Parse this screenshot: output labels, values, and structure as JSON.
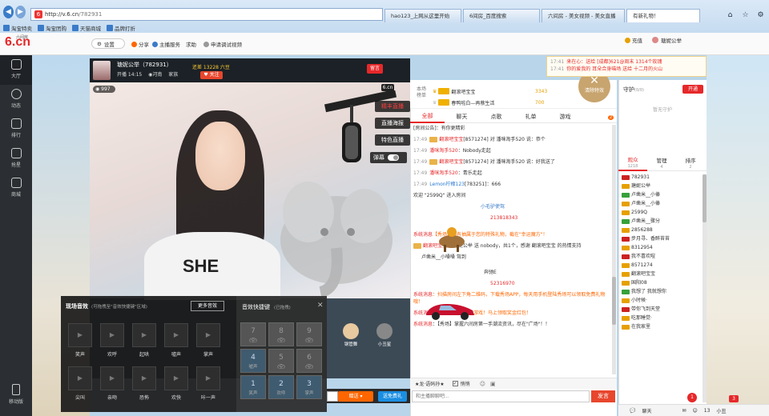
{
  "browser": {
    "url_prefix": "http://",
    "url_host": "v.6.cn",
    "url_path": "/782931",
    "tabs": [
      {
        "label": "hao123_上网从这里开始"
      },
      {
        "label": "6间房_百度搜索"
      },
      {
        "label": "六间房 - 美女视频 - 美女直播"
      },
      {
        "label": "有新礼物！"
      }
    ],
    "favorites": [
      "淘宝特卖",
      "淘宝团购",
      "天猫商城",
      "品牌打折"
    ]
  },
  "site": {
    "logo_text": "6.cn",
    "logo_sub": "六间房",
    "settings_label": "设置",
    "share_label": "分享",
    "host_service_label": "主播服务",
    "help_label": "求助",
    "apply_debug_label": "申请调试视频",
    "top_right": {
      "expand_label": "充值",
      "user_label": "瑭妮公举"
    }
  },
  "sidebar": {
    "items": [
      {
        "label": "大厅"
      },
      {
        "label": "动态"
      },
      {
        "label": "排行"
      },
      {
        "label": "抢星"
      },
      {
        "label": "商城"
      }
    ],
    "mobile_label": "移动版"
  },
  "stream": {
    "host_name": "瑭妮公举（782931）",
    "level_label": "还差 13228 六豆",
    "time_label": "开播 14:15",
    "location": "河南",
    "family_label": "家族",
    "follow_label": "关注",
    "live_badge": "留言",
    "viewer_count": "997",
    "logo_badge": "6.cn",
    "shirt_text": "SHE",
    "video_buttons": [
      "精丰直播",
      "直播海报",
      "特色直播"
    ],
    "bullet_label": "弹幕"
  },
  "sound_panel": {
    "title": "现场音效",
    "hint": "(可拖拽至\"音效快捷键\"区域)",
    "more_label": "更多音效",
    "effects": [
      {
        "label": "笑声"
      },
      {
        "label": "欢呼"
      },
      {
        "label": "起哄"
      },
      {
        "label": "嘘声"
      },
      {
        "label": "掌声"
      },
      {
        "label": "尖叫"
      },
      {
        "label": "亲吻"
      },
      {
        "label": "恐怖"
      },
      {
        "label": "欢快"
      },
      {
        "label": "咔一声"
      }
    ]
  },
  "hotkey_panel": {
    "title": "音效快捷键",
    "subtitle": "(已拖拽)",
    "close_label": "✕",
    "keys": [
      {
        "num": "7",
        "label": "(空)",
        "on": false
      },
      {
        "num": "8",
        "label": "(空)",
        "on": false
      },
      {
        "num": "9",
        "label": "(空)",
        "on": false
      },
      {
        "num": "4",
        "label": "嘘声",
        "on": true
      },
      {
        "num": "5",
        "label": "(空)",
        "on": false
      },
      {
        "num": "6",
        "label": "(空)",
        "on": false
      },
      {
        "num": "1",
        "label": "笑声",
        "on": true
      },
      {
        "num": "2",
        "label": "欢呼",
        "on": true
      },
      {
        "num": "3",
        "label": "掌声",
        "on": true
      }
    ]
  },
  "side_gifts": [
    {
      "label": "钢管舞"
    },
    {
      "label": "小丑星"
    }
  ],
  "gift_bar": {
    "send_label": "赠送",
    "send_all_label": "送免费礼"
  },
  "rank": {
    "label": "本场榜单",
    "rows": [
      {
        "name": "翻滚吧宝宝",
        "coins": "3343"
      },
      {
        "name": "春鸭啦白—再蔡生活",
        "coins": "700"
      }
    ]
  },
  "close_bubble": {
    "label": "清除特效"
  },
  "chat": {
    "tabs": [
      {
        "label": "全部",
        "active": true
      },
      {
        "label": "聊天",
        "active": false
      },
      {
        "label": "点歌",
        "active": false
      },
      {
        "label": "礼单",
        "active": false
      },
      {
        "label": "游戏",
        "active": false
      }
    ],
    "badge_count": "2",
    "announcement": "[房间公告]：有你更精彩",
    "messages": [
      {
        "time": "17:49",
        "user": "翻滚吧宝宝",
        "text": "[8571274] 对 潘咪淘手520 说：恭个"
      },
      {
        "time": "17:49",
        "user": "潘咪淘手520",
        "text": "：Nobody走起"
      },
      {
        "time": "17:49",
        "user": "翻滚吧宝宝",
        "text": "[8571274] 对 潘咪淘手520 说：好我送了"
      },
      {
        "time": "17:49",
        "user": "潘咪淘手520",
        "text": "：青乐走起"
      },
      {
        "time": "17:49",
        "user": "Lemon柠檬123",
        "text": "[783251]：666"
      },
      {
        "time": "",
        "user": "",
        "text": "欢迎 \"2599Q\" 进入房间"
      },
      {
        "time": "",
        "user": "",
        "text": "小毛驴使驾"
      },
      {
        "time": "",
        "user": "",
        "text": "213818343"
      },
      {
        "time": "",
        "user": "系统消息",
        "text": "【秀场】抽有抽属于您的特殊礼物，截在\"幸运魔方\"！"
      },
      {
        "time": "",
        "user": "翻滚吧宝宝",
        "text": "向 瑭妮公举 送 nobody，共1个，感谢 翻滚吧宝宝 的热情支持"
      },
      {
        "time": "",
        "user": "",
        "text": "卢凿米__小嗓嗓 驾到"
      },
      {
        "time": "",
        "user": "",
        "text": "奔驰E"
      },
      {
        "time": "",
        "user": "",
        "text": "52316970"
      },
      {
        "time": "",
        "user": "系统消息",
        "text": "：扫描房间左下角二维码，下载秀场APP，每天用手机登陆秀场可以领取免费礼物哦！"
      },
      {
        "time": "",
        "user": "系统消息",
        "text": "：【游戏】超赚钱的游戏！马上领取奖金红包！"
      },
      {
        "time": "",
        "user": "系统消息",
        "text": "：【秀场】掌握六间房第一手潮流资讯，尽在\"广场\"！！"
      }
    ],
    "footer_label": "★龙·语码孙★",
    "private_label": "悄悄",
    "input_placeholder": "和主播聊聊吧...",
    "send_label": "发言"
  },
  "notice": {
    "lines": [
      {
        "time": "17:41",
        "text": "来在心：送给 [成都]621@周末 1314个玫瑰"
      },
      {
        "time": "17:41",
        "text": "你的爱我的 耳朵合身喵场 送给 十二月的火山"
      }
    ]
  },
  "guard": {
    "title": "守护",
    "count": "(0/0)",
    "open_label": "开通",
    "empty_label": "暂无守护"
  },
  "user_tabs": [
    {
      "label": "观众",
      "count": "1218",
      "active": true
    },
    {
      "label": "管理",
      "count": "4",
      "active": false
    },
    {
      "label": "排序",
      "count": "2",
      "active": false
    }
  ],
  "users": [
    {
      "name": "782931",
      "lv": "r"
    },
    {
      "name": "瑭妮公举",
      "lv": ""
    },
    {
      "name": "卢凿米__小傣",
      "lv": "g"
    },
    {
      "name": "卢凿米__小傣",
      "lv": ""
    },
    {
      "name": "2599Q",
      "lv": ""
    },
    {
      "name": "卢凿米__骤分",
      "lv": "g"
    },
    {
      "name": "2856288",
      "lv": ""
    },
    {
      "name": "步月寻、香醉苔苔",
      "lv": "r"
    },
    {
      "name": "8312954",
      "lv": ""
    },
    {
      "name": "我不喜欢喧",
      "lv": "r"
    },
    {
      "name": "8571274",
      "lv": ""
    },
    {
      "name": "翻滚吧宝宝",
      "lv": ""
    },
    {
      "name": "国阳08",
      "lv": ""
    },
    {
      "name": "我想了 我就想你",
      "lv": "g"
    },
    {
      "name": "小时候·",
      "lv": ""
    },
    {
      "name": "带你飞到天堂",
      "lv": "r"
    },
    {
      "name": "吃那睡觉·",
      "lv": ""
    },
    {
      "name": "在我家里",
      "lv": ""
    }
  ],
  "bottom_bar": {
    "chat_label": "聊天",
    "count1": "1",
    "count2": "3",
    "count3": "13",
    "label_tail": "小丑"
  }
}
